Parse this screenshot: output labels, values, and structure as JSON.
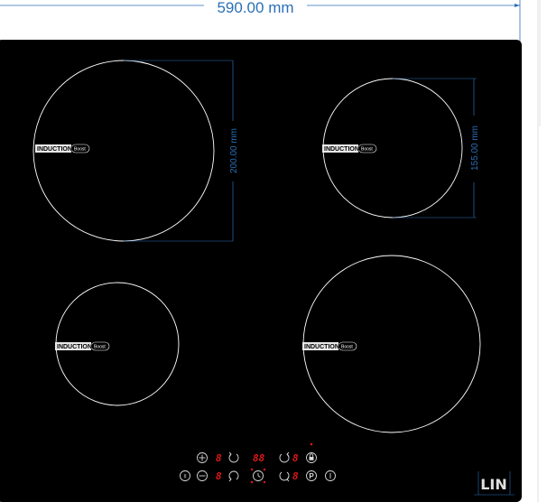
{
  "dimensions": {
    "width_label": "590.00 mm",
    "zone1_diameter_label": "200.00 mm",
    "zone2_diameter_label": "155.00 mm"
  },
  "zones": [
    {
      "label": "INDUCTION",
      "boost": "Boost"
    },
    {
      "label": "INDUCTION",
      "boost": "Boost"
    },
    {
      "label": "INDUCTION",
      "boost": "Boost"
    },
    {
      "label": "INDUCTION",
      "boost": "Boost"
    }
  ],
  "controls": {
    "displays": {
      "zone_top_left": "8",
      "timer": "88",
      "zone_top_right": "8",
      "zone_bottom_left": "8",
      "zone_bottom_right": "8"
    },
    "pause_symbol": "II",
    "p_symbol": "P"
  },
  "brand": {
    "logo": "LIN"
  },
  "colors": {
    "glass": "#000000",
    "zone_outline": "#ffffff",
    "dimension": "#2b6fb6",
    "display_red": "#e01818"
  }
}
